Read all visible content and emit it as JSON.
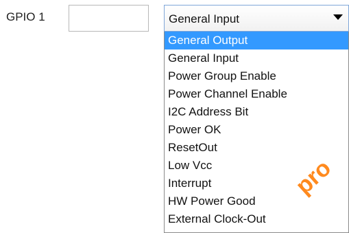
{
  "form": {
    "gpio_label": "GPIO 1",
    "gpio_text_value": "",
    "select": {
      "current_value": "General Input",
      "open": true
    },
    "dropdown_options": [
      {
        "label": "General Output",
        "selected": true
      },
      {
        "label": "General Input",
        "selected": false
      },
      {
        "label": "Power Group Enable",
        "selected": false
      },
      {
        "label": "Power Channel Enable",
        "selected": false
      },
      {
        "label": "I2C Address Bit",
        "selected": false
      },
      {
        "label": "Power OK",
        "selected": false
      },
      {
        "label": "ResetOut",
        "selected": false
      },
      {
        "label": "Low Vcc",
        "selected": false
      },
      {
        "label": "Interrupt",
        "selected": false
      },
      {
        "label": "HW Power Good",
        "selected": false
      },
      {
        "label": "External Clock-Out",
        "selected": false
      }
    ]
  },
  "watermark": {
    "text": "pro"
  },
  "colors": {
    "selection_background": "#3399ff",
    "selection_text": "#ffffff",
    "watermark": "#ff7a00"
  },
  "icons": {
    "dropdown_chevron": "chevron-down-icon"
  }
}
